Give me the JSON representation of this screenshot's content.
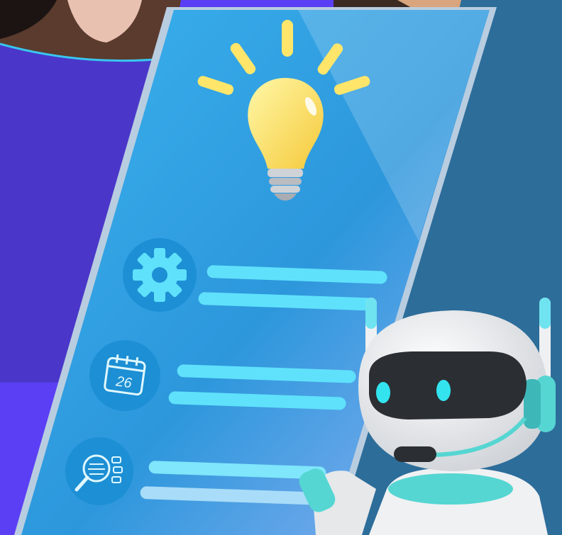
{
  "colors": {
    "background": "#5b3ff5",
    "panel_dark": "#4a37c9",
    "screen_blue": "#2ea3e3",
    "bar_cyan": "#5fe1fb",
    "bulb_yellow": "#ffe66b",
    "robot_white": "#f4f4f4",
    "robot_teal": "#55d6d2"
  },
  "screen": {
    "items": [
      {
        "icon": "gear-icon"
      },
      {
        "icon": "calendar-icon",
        "date_text": "26"
      },
      {
        "icon": "search-data-icon"
      }
    ]
  },
  "hero_icon": "lightbulb-icon",
  "mascot": "robot-mascot"
}
